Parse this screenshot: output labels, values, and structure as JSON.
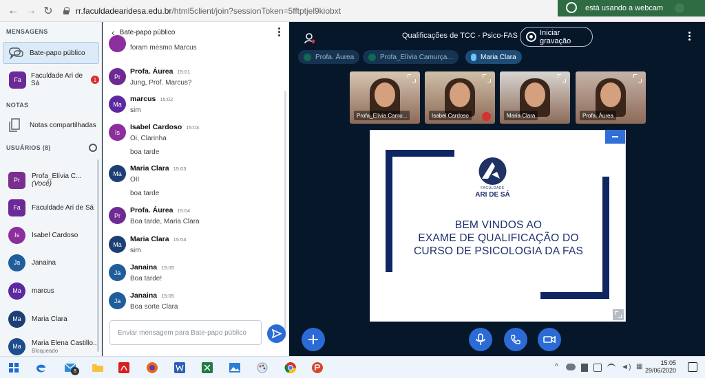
{
  "browser": {
    "url_domain": "rr.faculdadearidesa.edu.br",
    "url_path": "/html5client/join?sessionToken=5fftptjel9kiobxt",
    "notification_text": "está usando a webcam"
  },
  "sidebar": {
    "messages_title": "MENSAGENS",
    "public_chat_label": "Bate-papo público",
    "group_chat": {
      "avatar": "Fa",
      "label": "Faculdade Ari de Sá",
      "badge": "1"
    },
    "notes_title": "NOTAS",
    "shared_notes_label": "Notas compartilhadas",
    "users_title": "USUÁRIOS (8)",
    "users": [
      {
        "avatar": "Pr",
        "name": "Profa_Elívia C...",
        "suffix": "(Você)",
        "color": "#7a2f8f",
        "status": "#1a7a70"
      },
      {
        "avatar": "Fa",
        "name": "Faculdade Ari de Sá",
        "suffix": "",
        "color": "#6b2a96",
        "status": "#0f6a72"
      },
      {
        "avatar": "Is",
        "name": "Isabel Cardoso",
        "suffix": "",
        "color": "#8d2e9d",
        "status": "#d82f2f"
      },
      {
        "avatar": "Ja",
        "name": "Janaina",
        "suffix": "",
        "color": "#1f5d9b",
        "status": "#d82f2f"
      },
      {
        "avatar": "Ma",
        "name": "marcus",
        "suffix": "",
        "color": "#5c2aa0",
        "status": "#d82f2f"
      },
      {
        "avatar": "Ma",
        "name": "Maria Clara",
        "suffix": "",
        "color": "#1d3f75",
        "status": "#1a8a60"
      },
      {
        "avatar": "Ma",
        "name": "Maria Elena Castillo...",
        "suffix": "",
        "color": "#1d4d8d",
        "status": "",
        "sub": "Bloqueado"
      }
    ]
  },
  "chat": {
    "title": "Bate-papo público",
    "partial_message": "foram mesmo Marcus",
    "messages": [
      {
        "avatar": "Pr",
        "color": "#6d2a94",
        "name": "Profa. Áurea",
        "time": "15:01",
        "lines": [
          "Jung, Prof. Marcus?"
        ]
      },
      {
        "avatar": "Ma",
        "color": "#5c2aa0",
        "name": "marcus",
        "time": "15:02",
        "lines": [
          "sim"
        ]
      },
      {
        "avatar": "Is",
        "color": "#8d2e9d",
        "name": "Isabel Cardoso",
        "time": "15:03",
        "lines": [
          "Oi, Clarinha",
          "boa tarde"
        ]
      },
      {
        "avatar": "Ma",
        "color": "#1d3f75",
        "name": "Maria Clara",
        "time": "15:03",
        "lines": [
          "OII",
          "boa tarde"
        ]
      },
      {
        "avatar": "Pr",
        "color": "#6d2a94",
        "name": "Profa. Áurea",
        "time": "15:04",
        "lines": [
          "Boa tarde, Maria Clara"
        ]
      },
      {
        "avatar": "Ma",
        "color": "#1d3f75",
        "name": "Maria Clara",
        "time": "15:04",
        "lines": [
          "sim"
        ]
      },
      {
        "avatar": "Ja",
        "color": "#1f5d9b",
        "name": "Janaina",
        "time": "15:05",
        "lines": [
          "Boa tarde!"
        ]
      },
      {
        "avatar": "Ja",
        "color": "#1f5d9b",
        "name": "Janaina",
        "time": "15:05",
        "lines": [
          "Boa sorte Clara"
        ]
      }
    ],
    "input_placeholder": "Enviar mensagem para Bate-papo público"
  },
  "main": {
    "session_title": "Qualificações de TCC - Psico-FAS",
    "record_label": "Iniciar gravação",
    "talkers": [
      {
        "label": "Profa. Áurea",
        "active": false
      },
      {
        "label": "Profa_Elívia Camurça...",
        "active": false
      },
      {
        "label": "Maria Clara",
        "active": true
      }
    ],
    "videos": [
      {
        "label": "Profa_Elívia Camu...",
        "bg": "#d7c5b2"
      },
      {
        "label": "Isabel Cardoso",
        "bg": "#cfc0a8",
        "muted": true
      },
      {
        "label": "Maria Clara",
        "bg": "#d8d5d2"
      },
      {
        "label": "Profa. Áurea",
        "bg": "#c6b3a8"
      }
    ],
    "slide": {
      "logo_small": "FACULDADE",
      "logo_main": "ARI DE SÁ",
      "lines": [
        "BEM VINDOS AO",
        "EXAME DE QUALIFICAÇÃO DO",
        "CURSO DE PSICOLOGIA DA FAS"
      ]
    }
  },
  "taskbar": {
    "time": "15:05",
    "date": "29/06/2020",
    "mail_badge": "8"
  },
  "colors": {
    "primary": "#2c6bd5",
    "stage_bg": "#06172a",
    "slide_navy": "#0e2763"
  }
}
